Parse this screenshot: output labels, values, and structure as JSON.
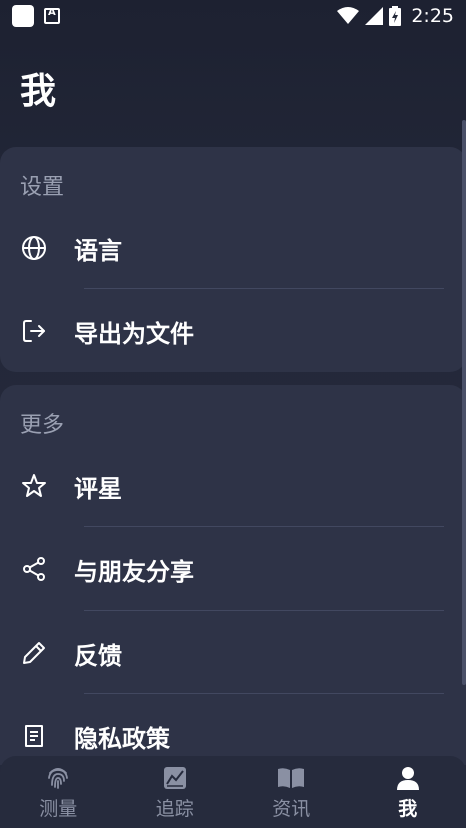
{
  "status_bar": {
    "time": "2:25"
  },
  "page": {
    "title": "我"
  },
  "settings_section": {
    "header": "设置",
    "items": [
      {
        "label": "语言",
        "icon": "globe-icon"
      },
      {
        "label": "导出为文件",
        "icon": "export-icon"
      }
    ]
  },
  "more_section": {
    "header": "更多",
    "items": [
      {
        "label": "评星",
        "icon": "star-icon"
      },
      {
        "label": "与朋友分享",
        "icon": "share-icon"
      },
      {
        "label": "反馈",
        "icon": "pencil-icon"
      },
      {
        "label": "隐私政策",
        "icon": "document-icon"
      }
    ]
  },
  "bottom_nav": {
    "items": [
      {
        "label": "测量",
        "icon": "fingerprint-icon",
        "active": false
      },
      {
        "label": "追踪",
        "icon": "chart-icon",
        "active": false
      },
      {
        "label": "资讯",
        "icon": "book-icon",
        "active": false
      },
      {
        "label": "我",
        "icon": "person-icon",
        "active": true
      }
    ]
  },
  "colors": {
    "background": "#232839",
    "card": "#2e3347",
    "text_primary": "#ffffff",
    "text_secondary": "#9aa0b2",
    "nav_inactive": "#8a90a3"
  }
}
